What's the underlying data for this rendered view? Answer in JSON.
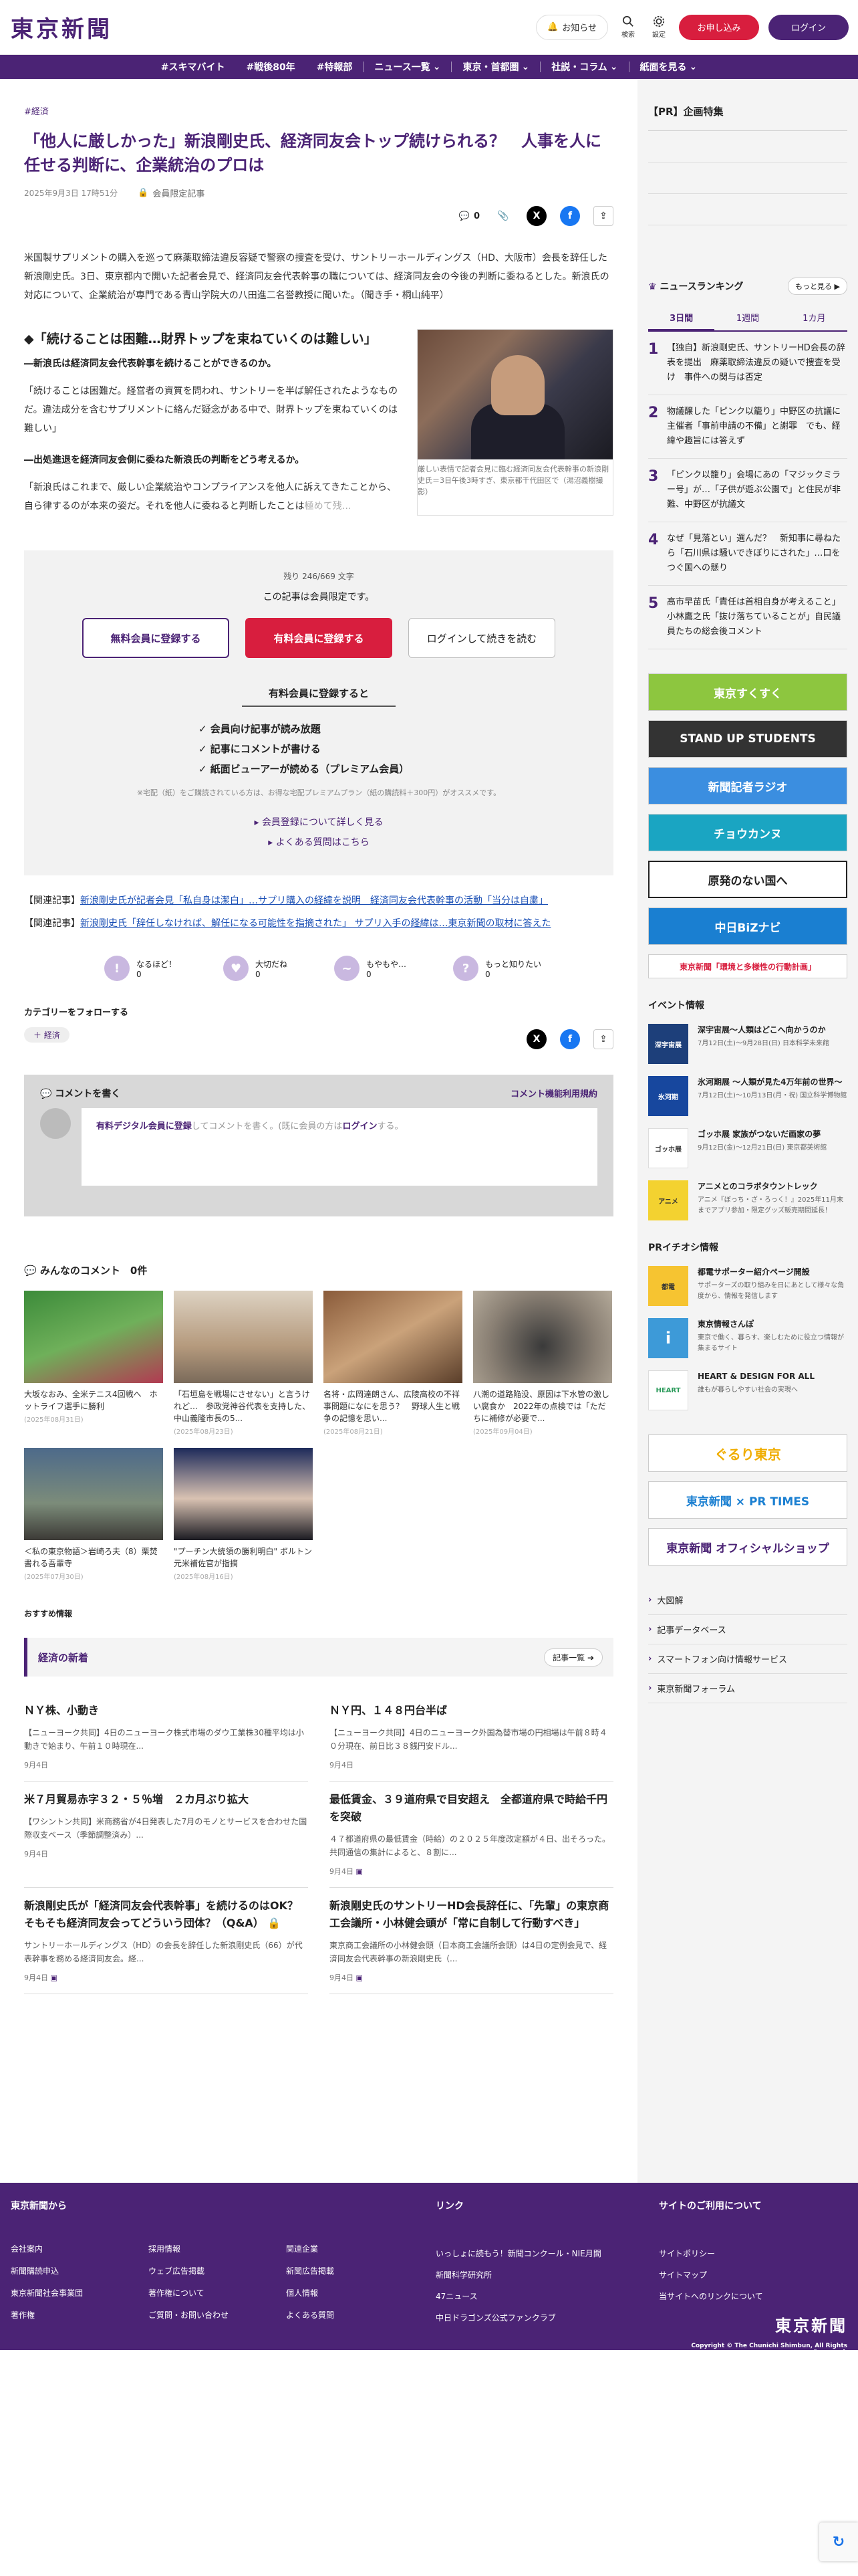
{
  "header": {
    "logo": "東京新聞",
    "notice": "お知らせ",
    "search": "検索",
    "settings": "設定",
    "signup": "お申し込み",
    "login": "ログイン"
  },
  "nav": [
    "#スキマバイト",
    "#戦後80年",
    "#特報部",
    "ニュース一覧",
    "東京・首都圏",
    "社説・コラム",
    "紙面を見る"
  ],
  "article": {
    "breadcrumb": "#経済",
    "title": "「他人に厳しかった」新浪剛史氏、経済同友会トップ続けられる？　人事を人に任せる判断に、企業統治のプロは",
    "date": "2025年9月3日 17時51分",
    "member_label": "会員限定記事",
    "comment_count": "0",
    "lead": "米国製サプリメントの購入を巡って麻薬取締法違反容疑で警察の捜査を受け、サントリーホールディングス（HD、大阪市）会長を辞任した新浪剛史氏。3日、東京都内で開いた記者会見で、経済同友会代表幹事の職については、経済同友会の今後の判断に委ねるとした。新浪氏の対応について、企業統治が専門である青山学院大の八田進二名誉教授に聞いた。（聞き手・桐山純平）",
    "subhead": "◆「続けることは困難…財界トップを束ねていくのは難しい」",
    "q1": "―新浪氏は経済同友会代表幹事を続けることができるのか。",
    "a1": "「続けることは困難だ。経営者の資質を問われ、サントリーを半ば解任されたようなものだ。違法成分を含むサプリメントに絡んだ疑念がある中で、財界トップを束ねていくのは難しい」",
    "q2": "―出処進退を経済同友会側に委ねた新浪氏の判断をどう考えるか。",
    "a2": "「新浪氏はこれまで、厳しい企業統治やコンプライアンスを他人に訴えてきたことから、自ら律するのが本来の姿だ。それを他人に委ねると判断したことは",
    "a2_fade": "極めて残…",
    "photo_caption": "厳しい表情で記者会見に臨む経済同友会代表幹事の新浪剛史氏＝3日午後3時すぎ、東京都千代田区で（潟沼義樹撮影）"
  },
  "paywall": {
    "remaining": "残り 246/669 文字",
    "limited": "この記事は会員限定です。",
    "free_button": "無料会員に登録する",
    "paid_button": "有料会員に登録する",
    "login_button": "ログインして続きを読む",
    "benefit_title": "有料会員に登録すると",
    "benefits": [
      "✓ 会員向け記事が読み放題",
      "✓ 記事にコメントが書ける",
      "✓ 紙面ビューアーが読める（プレミアム会員）"
    ],
    "note": "※宅配（紙）をご購読されている方は、お得な宅配プレミアムプラン（紙の購読料＋300円）がオススメです。",
    "link1": "会員登録について詳しく見る",
    "link2": "よくある質問はこちら"
  },
  "related": [
    {
      "label": "【関連記事】",
      "text": "新浪剛史氏が記者会見「私自身は潔白」…サプリ購入の経緯を説明　経済同友会代表幹事の活動「当分は自粛」"
    },
    {
      "label": "【関連記事】",
      "text": "新浪剛史氏「辞任しなければ、解任になる可能性を指摘された」 サプリ入手の経緯は…東京新聞の取材に答えた"
    }
  ],
  "reactions": [
    {
      "label": "なるほど！",
      "count": "0",
      "face": "!"
    },
    {
      "label": "大切だね",
      "count": "0",
      "face": "♥"
    },
    {
      "label": "もやもや…",
      "count": "0",
      "face": "~"
    },
    {
      "label": "もっと知りたい",
      "count": "0",
      "face": "?"
    }
  ],
  "follow": {
    "title": "カテゴリーをフォローする",
    "tag": "＋ 経済"
  },
  "comment_form": {
    "title": "コメントを書く",
    "policy": "コメント機能利用規約",
    "link": "有料デジタル会員に登録",
    "text_mid": "してコメントを書く。(既に会員の方は",
    "login": "ログイン",
    "text_end": "する。"
  },
  "comments_title": "みんなのコメント　0件",
  "photo_cards": [
    {
      "caption": "大坂なおみ、全米テニス4回戦へ　ホットライフ選手に勝利",
      "date": "(2025年08月31日)"
    },
    {
      "caption": "「石垣島を戦場にさせない」と言うけれど…　参政党神谷代表を支持した、中山義隆市長の5...",
      "date": "(2025年08月23日)"
    },
    {
      "caption": "名将・広岡達朗さん、広陵高校の不祥事問題になにを思う？　野球人生と戦争の記憶を思い...",
      "date": "(2025年08月21日)"
    },
    {
      "caption": "八潮の道路陥没、原因は下水管の激しい腐食か　2022年の点検では「ただちに補修が必要で...",
      "date": "(2025年09月04日)"
    },
    {
      "caption": "＜私の東京物語＞岩崎ろ夫（8）栗焚書れる吾輩寺",
      "date": "(2025年07月30日)"
    },
    {
      "caption": "\"プーチン大統領の勝利明白\" ボルトン元米補佐官が指摘",
      "date": "(2025年08月16日)"
    }
  ],
  "recommend_label": "おすすめ情報",
  "econ": {
    "title": "経済の新着",
    "more": "記事一覧 ➔",
    "items": [
      {
        "h": "ＮＹ株、小動き",
        "b": "【ニューヨーク共同】4日のニューヨーク株式市場のダウ工業株30種平均は小動きで始まり、午前１０時現在...",
        "d": "9月4日"
      },
      {
        "h": "ＮＹ円、１４８円台半ば",
        "b": "【ニューヨーク共同】4日のニューヨーク外国為替市場の円相場は午前８時４０分現在、前日比３８銭円安ドル...",
        "d": "9月4日"
      },
      {
        "h": "米７月貿易赤字３２・５％増　２カ月ぶり拡大",
        "b": "【ワシントン共同】米商務省が4日発表した7月のモノとサービスを合わせた国際収支ベース（季節調整済み）...",
        "d": "9月4日"
      },
      {
        "h": "最低賃金、３９道府県で目安超え　全都道府県で時給千円を突破",
        "b": "４７都道府県の最低賃金（時給）の２０２５年度改定額が４日、出そろった。共同通信の集計によると、８割に...",
        "d": "9月4日"
      },
      {
        "h": "新浪剛史氏が「経済同友会代表幹事」を続けるのはOK？そもそも経済同友会ってどういう団体？（Q&A）",
        "b": "サントリーホールディングス（HD）の会長を辞任した新浪剛史氏（66）が代表幹事を務める経済同友会。経...",
        "d": "9月4日"
      },
      {
        "h": "新浪剛史氏のサントリーHD会長辞任に、「先輩」の東京商工会議所・小林健会頭が「常に自制して行動すべき」",
        "b": "東京商工会議所の小林健会頭（日本商工会議所会頭）は4日の定例会見で、経済同友会代表幹事の新浪剛史氏（...",
        "d": "9月4日"
      }
    ]
  },
  "sidebar": {
    "pr_title": "【PR】企画特集",
    "ranking_title": "ニュースランキング",
    "ranking_more": "もっと見る ▶",
    "tabs": [
      "3日間",
      "1週間",
      "1カ月"
    ],
    "ranking": [
      {
        "n": "1",
        "t": "【独自】新浪剛史氏、サントリーHD会長の辞表を提出　麻薬取締法違反の疑いで捜査を受け　事件への関与は否定"
      },
      {
        "n": "2",
        "t": "物議醸した「ピンク以籠り」中野区の抗議に主催者「事前申請の不備」と謝罪　でも、経緯や趣旨には答えず"
      },
      {
        "n": "3",
        "t": "「ピンク以籠り」会場にあの「マジックミラー号」が…「子供が遊ぶ公園で」と住民が非難、中野区が抗議文"
      },
      {
        "n": "4",
        "t": "なぜ「見落とい」選んだ？　新知事に尋ねたら「石川県は騒いできぼりにされた」…口を　つぐ国への懸り"
      },
      {
        "n": "5",
        "t": "高市早苗氏「責任は首相自身が考えること」 小林鷹之氏「抜け落ちていることが」自民議員たちの総会後コメント"
      }
    ],
    "banners": [
      {
        "text": "東京すくすく",
        "color": "#8dc63f"
      },
      {
        "text": "STAND UP STUDENTS",
        "color": "#333333"
      },
      {
        "text": "新聞記者ラジオ",
        "color": "#3b8ee0"
      },
      {
        "text": "チョウカンヌ",
        "color": "#1aa5c2"
      },
      {
        "text": "原発のない国へ",
        "color": "#222222"
      },
      {
        "text": "中日BiZナビ",
        "color": "#1a7fd1"
      },
      {
        "text": "東京新聞「環境と多様性の行動計画」",
        "color": "#d81e3e"
      }
    ],
    "event_title": "イベント情報",
    "events": [
      {
        "t": "深宇宙展〜人類はどこへ向かうのか",
        "d": "7月12日(土)〜9月28日(日) 日本科学未来館",
        "thumb": "深宇宙展",
        "bg": "#1d3f7a",
        "fg": "#fff"
      },
      {
        "t": "氷河期展 〜人類が見た4万年前の世界〜",
        "d": "7月12日(土)〜10月13日(月・祝) 国立科学博物館",
        "thumb": "氷河期",
        "bg": "#17479e",
        "fg": "#fff"
      },
      {
        "t": "ゴッホ展 家族がつないだ画家の夢",
        "d": "9月12日(金)〜12月21日(日) 東京都美術館",
        "thumb": "ゴッホ展",
        "bg": "#ffffff",
        "fg": "#333"
      },
      {
        "t": "アニメとのコラボタウントレック",
        "d": "アニメ『ぼっち・ざ・ろっく！』2025年11月末までアプリ参加・限定グッズ販売期間延長！",
        "thumb": "アニメ",
        "bg": "#f3d230",
        "fg": "#333"
      }
    ],
    "pr2_title": "PRイチオシ情報",
    "prs": [
      {
        "t": "都電サポーター紹介ページ開設",
        "d": "サポーターズの取り組みを日にあとして様々な角度から、情報を発信します",
        "thumb": "都電",
        "bg": "#f6c431",
        "fg": "#333"
      },
      {
        "t": "東京情報さんぽ",
        "d": "東京で働く、暮らす、楽しむために役立つ情報が集まるサイト",
        "thumb": "i",
        "bg": "#3d9ad8",
        "fg": "#fff"
      },
      {
        "t": "HEART & DESIGN FOR ALL",
        "d": "誰もが暮らしやすい社会の実現へ",
        "thumb": "HEART",
        "bg": "#ffffff",
        "fg": "#2a9a5a"
      }
    ],
    "banners2": [
      {
        "text": "ぐるり東京",
        "color": "#f0ad00"
      },
      {
        "text": "東京新聞 × PR TIMES",
        "color": "#1a7fd1"
      },
      {
        "text": "東京新聞 オフィシャルショップ",
        "color": "#4b2375"
      }
    ],
    "links": [
      "大図解",
      "記事データベース",
      "スマートフォン向け情報サービス",
      "東京新聞フォーラム"
    ]
  },
  "footer": {
    "col1": "東京新聞から",
    "col1_links": [
      "会社案内",
      "採用情報",
      "関連企業",
      "新聞購読申込",
      "ウェブ広告掲載",
      "新聞広告掲載",
      "東京新聞社会事業団",
      "著作権について",
      "個人情報",
      "著作権",
      "ご質問・お問い合わせ",
      "よくある質問"
    ],
    "col2": "リンク",
    "col2_links": [
      "いっしょに読もう！新聞コンクール・NIE月間",
      "新聞科学研究所",
      "47ニュース",
      "中日ドラゴンズ公式ファンクラブ"
    ],
    "col3": "サイトのご利用について",
    "col3_links": [
      "サイトポリシー",
      "サイトマップ",
      "当サイトへのリンクについて"
    ],
    "logo": "東京新聞",
    "copyright": "Copyright © The Chunichi Shimbun, All Rights Reserved."
  }
}
